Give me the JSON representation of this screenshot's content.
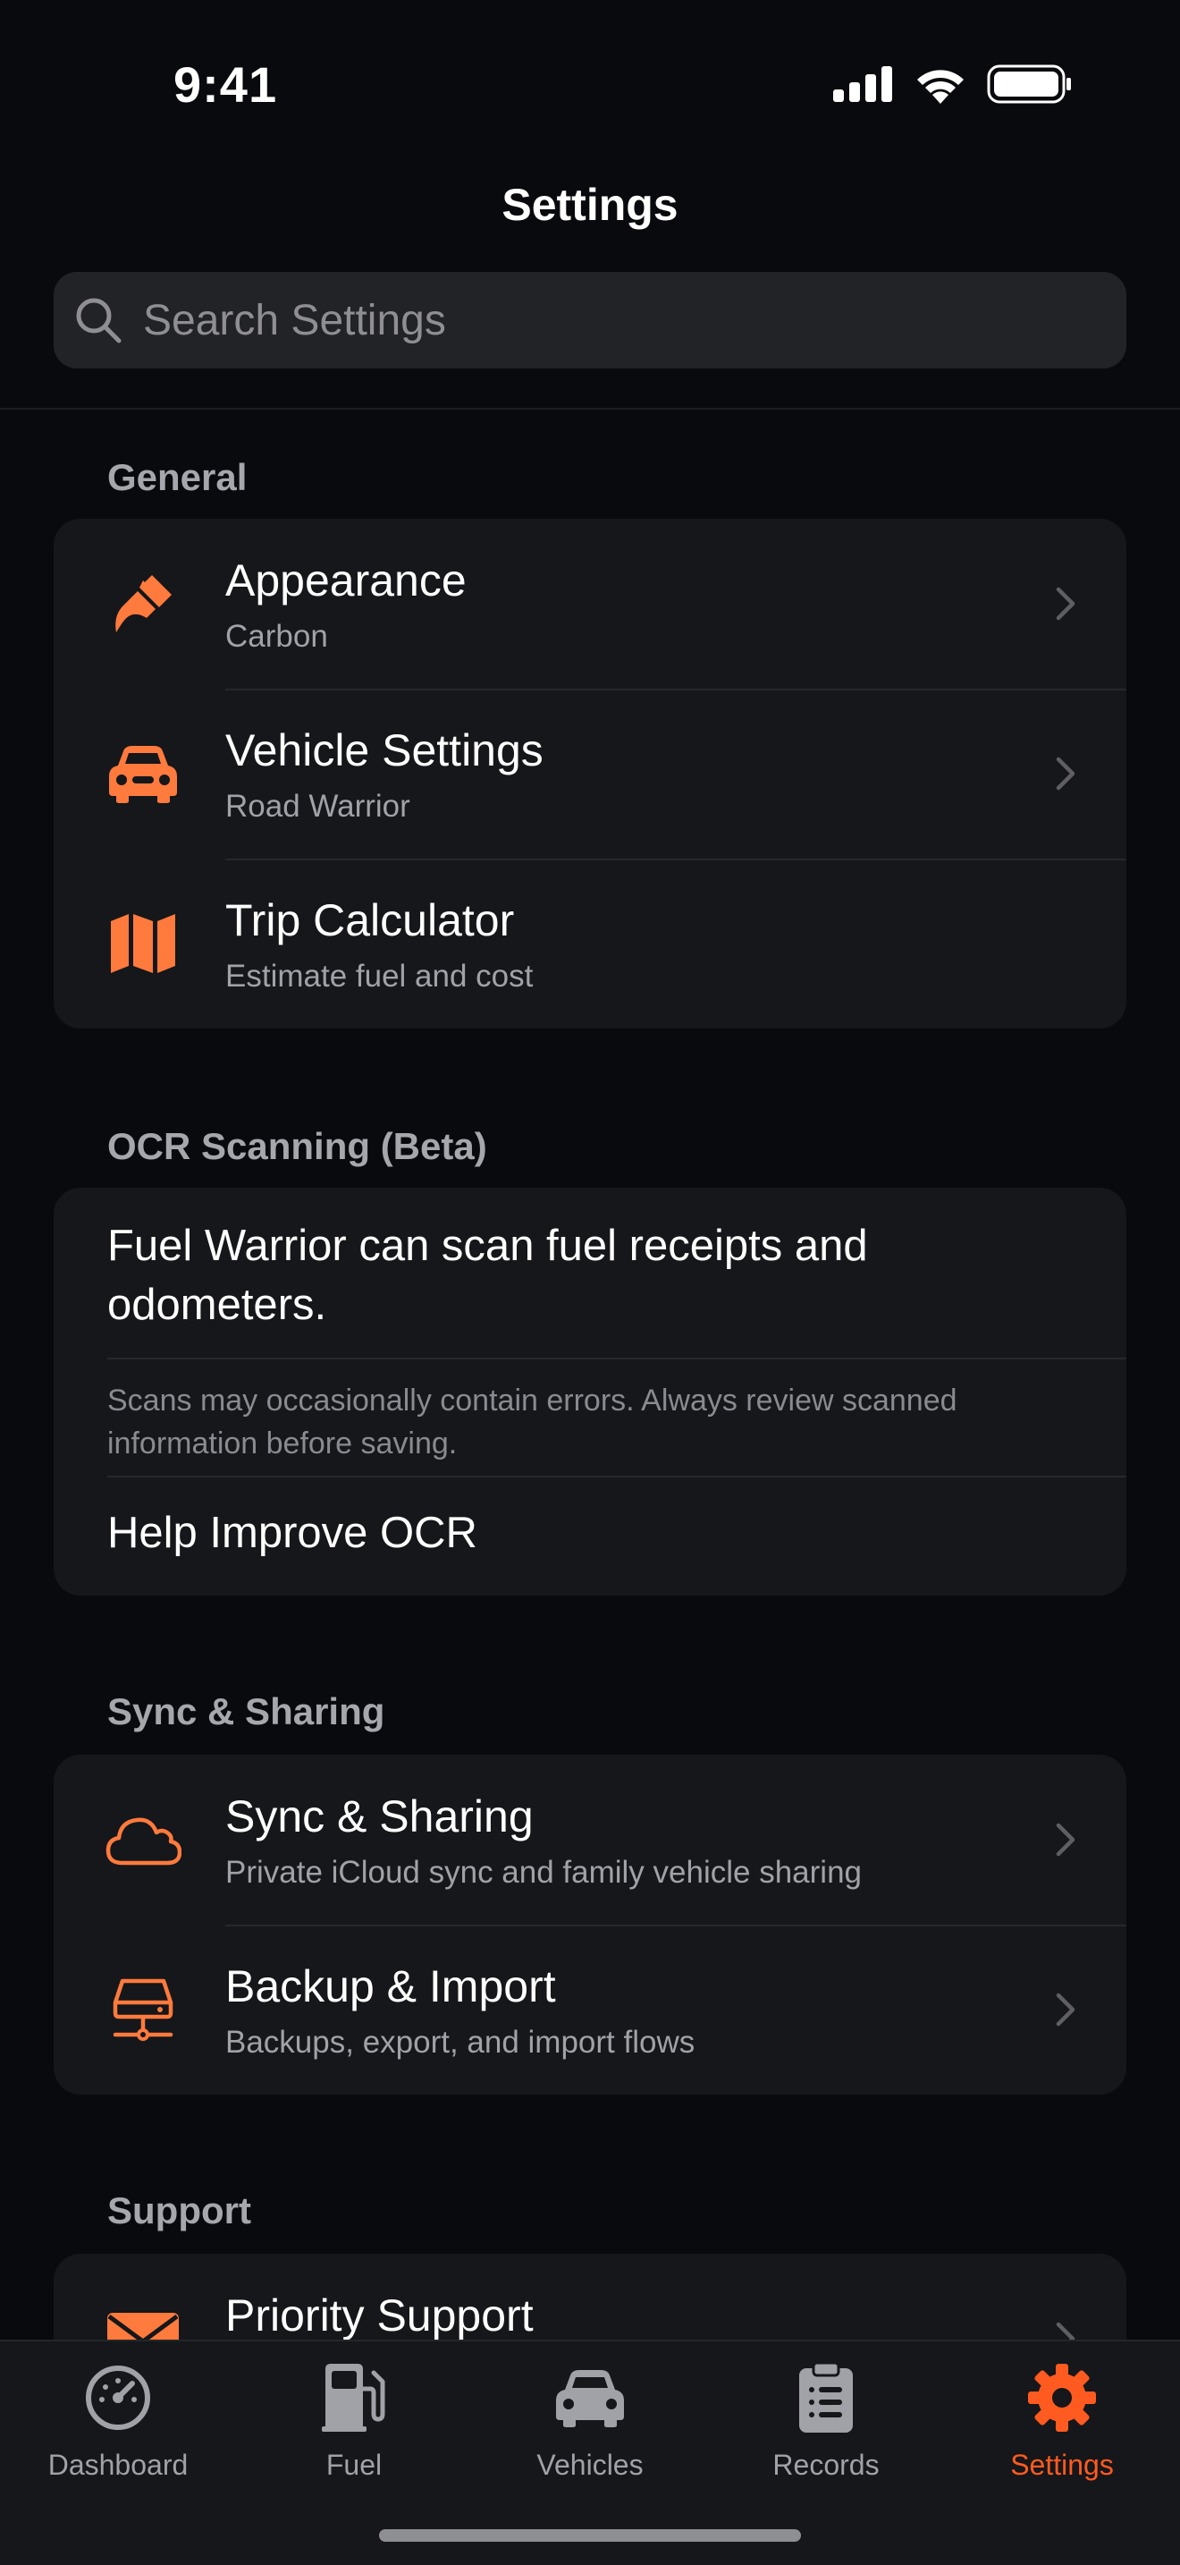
{
  "status_bar": {
    "time": "9:41"
  },
  "nav": {
    "title": "Settings"
  },
  "search": {
    "placeholder": "Search Settings"
  },
  "colors": {
    "accent": "#ff7a3d",
    "active_tab": "#ff5a1f",
    "background": "#090a0d",
    "card": "#15171a"
  },
  "sections": {
    "general": {
      "header": "General",
      "rows": [
        {
          "icon": "paintbrush-icon",
          "title": "Appearance",
          "subtitle": "Carbon"
        },
        {
          "icon": "car-icon",
          "title": "Vehicle Settings",
          "subtitle": "Road Warrior"
        },
        {
          "icon": "map-icon",
          "title": "Trip Calculator",
          "subtitle": "Estimate fuel and cost"
        }
      ]
    },
    "ocr": {
      "header": "OCR Scanning (Beta)",
      "description": "Fuel Warrior can scan fuel receipts and odometers.",
      "note": "Scans may occasionally contain errors. Always review scanned information before saving.",
      "link": "Help Improve OCR"
    },
    "sync": {
      "header": "Sync & Sharing",
      "rows": [
        {
          "icon": "cloud-icon",
          "title": "Sync & Sharing",
          "subtitle": "Private iCloud sync and family vehicle sharing"
        },
        {
          "icon": "server-icon",
          "title": "Backup & Import",
          "subtitle": "Backups, export, and import flows"
        }
      ]
    },
    "support": {
      "header": "Support",
      "rows": [
        {
          "icon": "envelope-icon",
          "title": "Priority Support"
        }
      ]
    }
  },
  "tabs": [
    {
      "icon": "gauge-icon",
      "label": "Dashboard",
      "active": false
    },
    {
      "icon": "fuel-pump-icon",
      "label": "Fuel",
      "active": false
    },
    {
      "icon": "car-icon",
      "label": "Vehicles",
      "active": false
    },
    {
      "icon": "clipboard-icon",
      "label": "Records",
      "active": false
    },
    {
      "icon": "gear-icon",
      "label": "Settings",
      "active": true
    }
  ]
}
